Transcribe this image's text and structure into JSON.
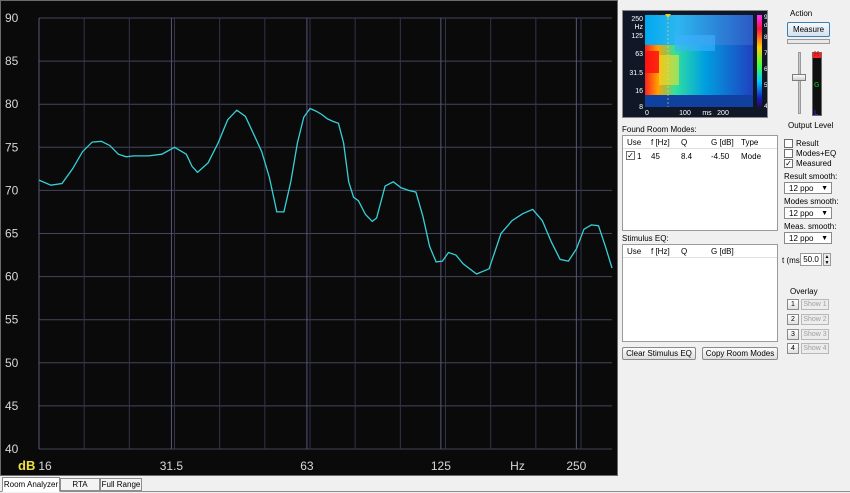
{
  "chart_data": {
    "type": "line",
    "x_unit": "Hz",
    "y_unit": "dB",
    "xscale": "log",
    "xlim": [
      16,
      300
    ],
    "ylim": [
      40,
      90
    ],
    "grid": true,
    "y_ticks": [
      "90",
      "85",
      "80",
      "75",
      "70",
      "65",
      "60",
      "55",
      "50",
      "45",
      "40"
    ],
    "x_ticks": [
      "16",
      "31.5",
      "63",
      "125",
      "250"
    ],
    "x_unit_label": "Hz",
    "y_unit_label": "dB",
    "series_color": "#38d0d8",
    "x": [
      16,
      17,
      18,
      19,
      20,
      21,
      22,
      23,
      24,
      25,
      26,
      27,
      28,
      30,
      32,
      34,
      35,
      36,
      38,
      40,
      42,
      44,
      46,
      48,
      50,
      52,
      54,
      56,
      58,
      60,
      62,
      64,
      66,
      68,
      70,
      72,
      74,
      76,
      78,
      80,
      82,
      85,
      88,
      90,
      94,
      98,
      102,
      106,
      110,
      114,
      118,
      122,
      126,
      130,
      135,
      140,
      150,
      160,
      170,
      180,
      190,
      200,
      210,
      220,
      230,
      240,
      250,
      260,
      270,
      280,
      290,
      300
    ],
    "y": [
      71.2,
      70.6,
      70.8,
      72.5,
      74.5,
      75.6,
      75.7,
      75.2,
      74.2,
      73.9,
      74.0,
      74.0,
      74.0,
      74.2,
      75.0,
      74.2,
      72.8,
      72.1,
      73.2,
      75.5,
      78.2,
      79.3,
      78.6,
      76.5,
      74.5,
      71.5,
      67.5,
      67.5,
      71.0,
      75.5,
      78.5,
      79.5,
      79.2,
      78.8,
      78.3,
      78.0,
      77.8,
      75.5,
      71.0,
      69.2,
      68.8,
      67.2,
      66.4,
      66.8,
      70.5,
      71.0,
      70.3,
      70.0,
      69.8,
      67.0,
      63.5,
      61.7,
      61.8,
      62.8,
      62.5,
      61.5,
      60.3,
      60.9,
      65.0,
      66.5,
      67.3,
      67.8,
      66.5,
      64.0,
      62.0,
      61.8,
      63.2,
      65.5,
      66.0,
      65.9,
      63.5,
      61.0
    ]
  },
  "spectrogram": {
    "y_ticks": [
      "250",
      "125",
      "63",
      "31.5",
      "16",
      "8"
    ],
    "y_unit": "Hz",
    "x_ticks": [
      "0",
      "100",
      "200"
    ],
    "x_unit": "ms",
    "scale_ticks": [
      "90",
      "80",
      "70",
      "60",
      "50",
      "40"
    ],
    "scale_unit": "dB"
  },
  "action": {
    "title": "Action",
    "measure_label": "Measure",
    "output_level_label": "Output Level",
    "meter_marks": [
      "H",
      "G",
      "L"
    ]
  },
  "modes": {
    "title": "Found Room Modes:",
    "columns": [
      "Use",
      "f [Hz]",
      "Q",
      "G [dB]",
      "Type"
    ],
    "rows": [
      {
        "checked": true,
        "use": "1",
        "f": "45",
        "q": "8.4",
        "g": "-4.50",
        "type": "Mode"
      }
    ]
  },
  "stimulus": {
    "title": "Stimulus EQ:",
    "columns": [
      "Use",
      "f [Hz]",
      "Q",
      "G [dB]"
    ]
  },
  "buttons": {
    "clear_eq": "Clear Stimulus EQ",
    "copy_modes": "Copy Room Modes"
  },
  "options": {
    "result": {
      "label": "Result",
      "checked": false
    },
    "modes_eq": {
      "label": "Modes+EQ",
      "checked": false
    },
    "measured": {
      "label": "Measured",
      "checked": true
    },
    "result_smooth_label": "Result smooth:",
    "result_smooth_value": "12 ppo",
    "modes_smooth_label": "Modes smooth:",
    "modes_smooth_value": "12 ppo",
    "meas_smooth_label": "Meas. smooth:",
    "meas_smooth_value": "12 ppo",
    "t_label": "t (ms)",
    "t_value": "50.0"
  },
  "overlay": {
    "title": "Overlay",
    "items": [
      {
        "num": "1",
        "show": "Show 1"
      },
      {
        "num": "2",
        "show": "Show 2"
      },
      {
        "num": "3",
        "show": "Show 3"
      },
      {
        "num": "4",
        "show": "Show 4"
      }
    ]
  },
  "tabs": [
    "Room Analyzer",
    "RTA",
    "Full Range"
  ]
}
